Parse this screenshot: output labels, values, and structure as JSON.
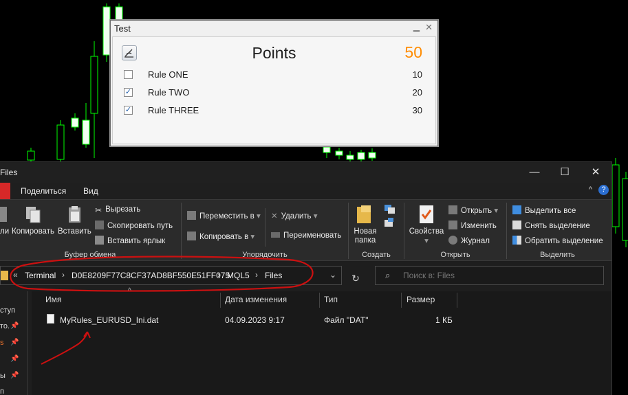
{
  "test_dialog": {
    "title": "Test",
    "heading": "Points",
    "total": "50",
    "total_color": "#ff8c00",
    "rules": [
      {
        "label": "Rule ONE",
        "checked": false,
        "value": "10"
      },
      {
        "label": "Rule TWO",
        "checked": true,
        "value": "20"
      },
      {
        "label": "Rule THREE",
        "checked": true,
        "value": "30"
      }
    ]
  },
  "explorer": {
    "title": "Files",
    "window_controls": {
      "minimize": "—",
      "maximize": "☐",
      "close": "✕"
    },
    "menu": {
      "share": "Поделиться",
      "view": "Вид"
    },
    "ribbon": {
      "clipboard": {
        "pin_label": "ли",
        "copy_label": "Копировать",
        "paste_label": "Вставить",
        "cut": "Вырезать",
        "copy_path": "Скопировать путь",
        "paste_shortcut": "Вставить ярлык",
        "group": "Буфер обмена"
      },
      "organize": {
        "move_to": "Переместить в",
        "copy_to": "Копировать в",
        "delete": "Удалить",
        "rename": "Переименовать",
        "group": "Упорядочить"
      },
      "new": {
        "new_folder": "Новая папка",
        "group": "Создать"
      },
      "open": {
        "properties": "Свойства",
        "open": "Открыть",
        "edit": "Изменить",
        "history": "Журнал",
        "group": "Открыть"
      },
      "select": {
        "select_all": "Выделить все",
        "select_none": "Снять выделение",
        "invert": "Обратить выделение",
        "group": "Выделить"
      }
    },
    "address": {
      "chevrons": "«",
      "crumbs": [
        "Terminal",
        "D0E8209F77C8CF37AD8BF550E51FF075",
        "MQL5",
        "Files"
      ],
      "separator": "›"
    },
    "search": {
      "placeholder": "Поиск в: Files"
    },
    "nav": [
      "ступ",
      "то.",
      "s",
      "",
      "ы",
      "п",
      "п"
    ],
    "columns": {
      "name": "Имя",
      "date": "Дата изменения",
      "type": "Тип",
      "size": "Размер"
    },
    "files": [
      {
        "name": "MyRules_EURUSD_Ini.dat",
        "date": "04.09.2023 9:17",
        "type": "Файл \"DAT\"",
        "size": "1 КБ"
      }
    ]
  },
  "colors": {
    "bull_candle": "#00ff00",
    "annotation": "#cc1010"
  }
}
